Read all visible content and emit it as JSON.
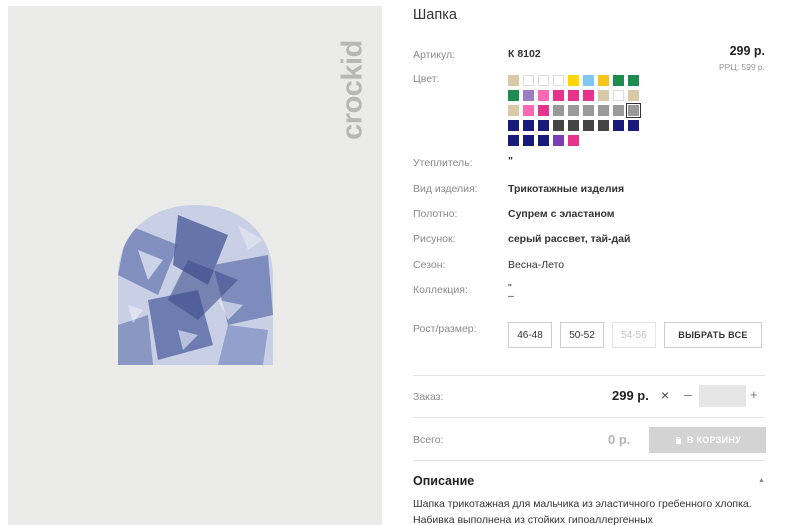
{
  "brand": {
    "logo_text": "crockid"
  },
  "product": {
    "title": "Шапка",
    "sku_label": "Артикул:",
    "sku": "К 8102",
    "price": "299 р.",
    "rrp": "РРЦ: 599 р.",
    "color_label": "Цвет:",
    "attributes": [
      {
        "label": "Утеплитель:",
        "value": "\""
      },
      {
        "label": "Вид изделия:",
        "value": "Трикотажные изделия"
      },
      {
        "label": "Полотно:",
        "value": "Супрем с эластаном"
      },
      {
        "label": "Рисунок:",
        "value": "серый рассвет, тай-дай"
      },
      {
        "label": "Сезон:",
        "value": "Весна-Лето"
      },
      {
        "label": "Коллекция:",
        "value": "\"",
        "value2": "–"
      }
    ],
    "swatches": [
      [
        "#d9c9a7",
        "#ffffff",
        "#ffffff",
        "#ffffff",
        "#ffd600",
        "#7ec7f1",
        "#f5c518",
        "#1e8c4e",
        "#1e8c4e"
      ],
      [
        "#1e8c4e",
        "#9b7fc4",
        "#ff69b4",
        "#e6338e",
        "#e6338e",
        "#e6338e",
        "#d9c9a7",
        "#ffffff",
        "#d9c9a7"
      ],
      [
        "#d9c9a7",
        "#ff69b4",
        "#e6338e",
        "#9a9a9a",
        "#9a9a9a",
        "#9a9a9a",
        "#9a9a9a",
        "#9a9a9a",
        "#9a9a9a"
      ],
      [
        "#1a1a7a",
        "#1a1a7a",
        "#1a1a7a",
        "#444444",
        "#444444",
        "#444444",
        "#444444",
        "#1a1a7a",
        "#1a1a7a"
      ],
      [
        "#1a1a7a",
        "#1a1a7a",
        "#1a1a7a",
        "#7b3fb5",
        "#e6338e"
      ]
    ],
    "size_label": "Рост/размер:",
    "sizes": [
      {
        "label": "46-48"
      },
      {
        "label": "50-52"
      },
      {
        "label": "54-56"
      }
    ],
    "select_all_label": "ВЫБРАТЬ ВСЕ"
  },
  "order": {
    "label": "Заказ:",
    "price": "299 р.",
    "times": "×",
    "minus": "–",
    "plus": "+",
    "qty": ""
  },
  "total": {
    "label": "Всего:",
    "value": "0 р.",
    "cart_label": "В КОРЗИНУ"
  },
  "description": {
    "title": "Описание",
    "toggle": "▲",
    "text": "Шапка трикотажная для мальчика из эластичного гребенного хлопка. Набивка выполнена из стойких гипоаллергенных"
  },
  "icons": {
    "cart": "cart-icon",
    "close": "times-icon",
    "collapse": "chevron-up-icon"
  }
}
